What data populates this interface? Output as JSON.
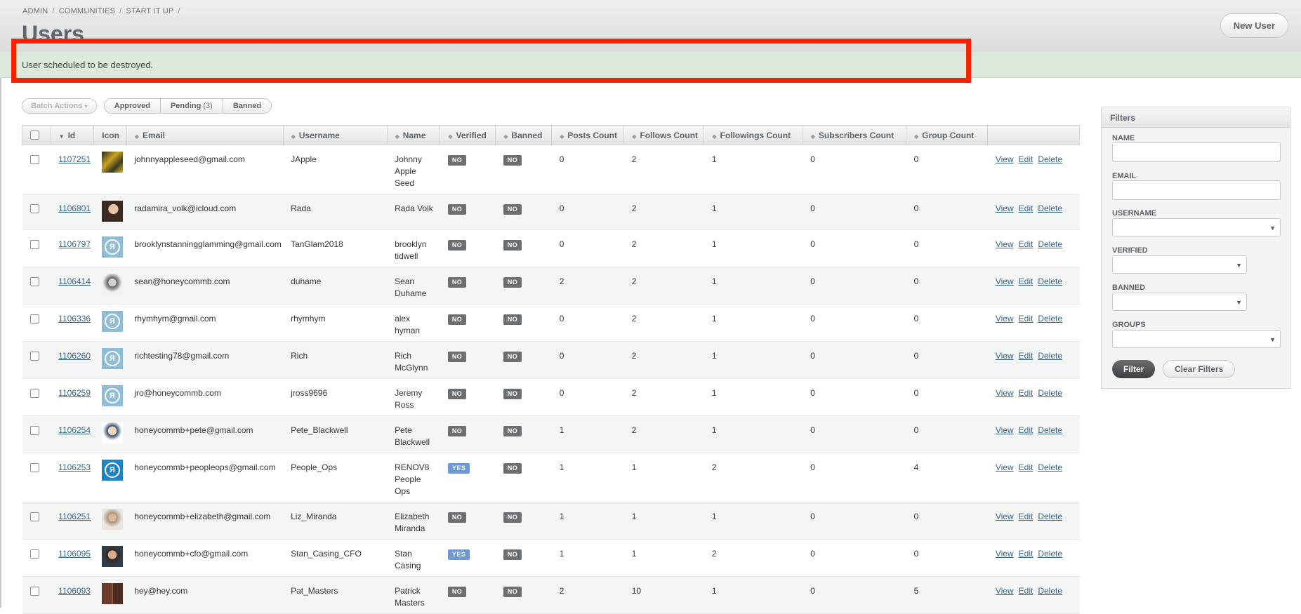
{
  "breadcrumb": {
    "items": [
      "ADMIN",
      "COMMUNITIES",
      "START IT UP"
    ],
    "trailing_sep": "/"
  },
  "page_title": "Users",
  "new_user_label": "New User",
  "flash": {
    "message": "User scheduled to be destroyed."
  },
  "highlight_color": "#ff2000",
  "batch_actions": {
    "label": "Batch Actions",
    "caret": "▾"
  },
  "scopes": {
    "approved": "Approved",
    "pending": "Pending",
    "pending_count": "(3)",
    "banned": "Banned"
  },
  "table": {
    "headers": [
      "Id",
      "Icon",
      "Email",
      "Username",
      "Name",
      "Verified",
      "Banned",
      "Posts Count",
      "Follows Count",
      "Followings Count",
      "Subscribers Count",
      "Group Count"
    ],
    "actions": {
      "view": "View",
      "edit": "Edit",
      "delete": "Delete"
    },
    "rows": [
      {
        "id": "1107251",
        "avatar": "photo-group",
        "email": "johnnyappleseed@gmail.com",
        "username": "JApple",
        "name": [
          "Johnny",
          "Apple",
          "Seed"
        ],
        "verified": "NO",
        "banned": "NO",
        "posts": "0",
        "follows": "2",
        "followings": "1",
        "subscribers": "0",
        "groups": "0"
      },
      {
        "id": "1106801",
        "avatar": "photo-person",
        "email": "radamira_volk@icloud.com",
        "username": "Rada",
        "name": [
          "Rada Volk"
        ],
        "verified": "NO",
        "banned": "NO",
        "posts": "0",
        "follows": "2",
        "followings": "1",
        "subscribers": "0",
        "groups": "0"
      },
      {
        "id": "1106797",
        "avatar": "default-logo",
        "email": "brooklynstanningglamming@gmail.com",
        "username": "TanGlam2018",
        "name": [
          "brooklyn",
          "tidwell"
        ],
        "verified": "NO",
        "banned": "NO",
        "posts": "0",
        "follows": "2",
        "followings": "1",
        "subscribers": "0",
        "groups": "0"
      },
      {
        "id": "1106414",
        "avatar": "photo-bw",
        "email": "sean@honeycommb.com",
        "username": "duhame",
        "name": [
          "Sean",
          "Duhame"
        ],
        "verified": "NO",
        "banned": "NO",
        "posts": "2",
        "follows": "2",
        "followings": "1",
        "subscribers": "0",
        "groups": "0"
      },
      {
        "id": "1106336",
        "avatar": "default-logo",
        "email": "rhymhym@gmail.com",
        "username": "rhymhym",
        "name": [
          "alex",
          "hyman"
        ],
        "verified": "NO",
        "banned": "NO",
        "posts": "0",
        "follows": "2",
        "followings": "1",
        "subscribers": "0",
        "groups": "0"
      },
      {
        "id": "1106260",
        "avatar": "default-logo",
        "email": "richtesting78@gmail.com",
        "username": "Rich",
        "name": [
          "Rich",
          "McGlynn"
        ],
        "verified": "NO",
        "banned": "NO",
        "posts": "0",
        "follows": "2",
        "followings": "1",
        "subscribers": "0",
        "groups": "0"
      },
      {
        "id": "1106259",
        "avatar": "default-logo",
        "email": "jro@honeycommb.com",
        "username": "jross9696",
        "name": [
          "Jeremy",
          "Ross"
        ],
        "verified": "NO",
        "banned": "NO",
        "posts": "0",
        "follows": "2",
        "followings": "1",
        "subscribers": "0",
        "groups": "0"
      },
      {
        "id": "1106254",
        "avatar": "photo-cartoon",
        "email": "honeycommb+pete@gmail.com",
        "username": "Pete_Blackwell",
        "name": [
          "Pete",
          "Blackwell"
        ],
        "verified": "NO",
        "banned": "NO",
        "posts": "1",
        "follows": "2",
        "followings": "1",
        "subscribers": "0",
        "groups": "0"
      },
      {
        "id": "1106253",
        "avatar": "brand-logo",
        "email": "honeycommb+peopleops@gmail.com",
        "username": "People_Ops",
        "name": [
          "RENOV8",
          "People",
          "Ops"
        ],
        "verified": "YES",
        "banned": "NO",
        "posts": "1",
        "follows": "1",
        "followings": "2",
        "subscribers": "0",
        "groups": "4"
      },
      {
        "id": "1106251",
        "avatar": "photo-light",
        "email": "honeycommb+elizabeth@gmail.com",
        "username": "Liz_Miranda",
        "name": [
          "Elizabeth",
          "Miranda"
        ],
        "verified": "NO",
        "banned": "NO",
        "posts": "1",
        "follows": "1",
        "followings": "1",
        "subscribers": "0",
        "groups": "0"
      },
      {
        "id": "1106095",
        "avatar": "photo-man",
        "email": "honeycommb+cfo@gmail.com",
        "username": "Stan_Casing_CFO",
        "name": [
          "Stan",
          "Casing"
        ],
        "verified": "YES",
        "banned": "NO",
        "posts": "1",
        "follows": "1",
        "followings": "2",
        "subscribers": "0",
        "groups": "0"
      },
      {
        "id": "1106093",
        "avatar": "photo-couple",
        "email": "hey@hey.com",
        "username": "Pat_Masters",
        "name": [
          "Patrick",
          "Masters"
        ],
        "verified": "NO",
        "banned": "NO",
        "posts": "2",
        "follows": "10",
        "followings": "1",
        "subscribers": "0",
        "groups": "5"
      }
    ]
  },
  "filters": {
    "title": "Filters",
    "name_label": "NAME",
    "email_label": "EMAIL",
    "username_label": "USERNAME",
    "verified_label": "VERIFIED",
    "banned_label": "BANNED",
    "groups_label": "GROUPS",
    "filter_button": "Filter",
    "clear_button": "Clear Filters"
  }
}
